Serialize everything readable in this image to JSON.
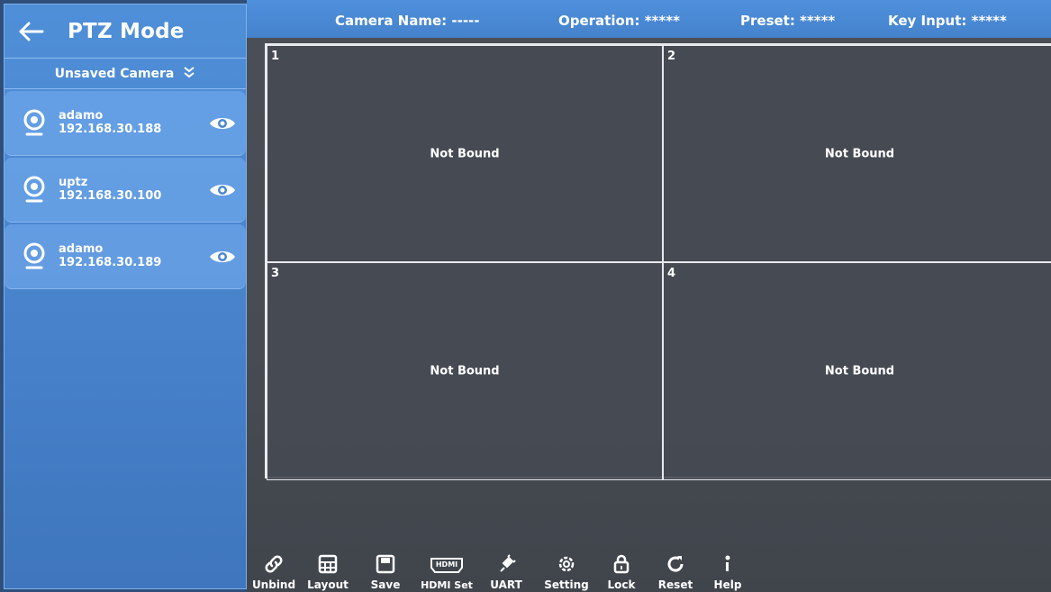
{
  "sidebar": {
    "title": "PTZ Mode",
    "subheader": "Unsaved Camera",
    "cameras": [
      {
        "name": "adamo",
        "ip": "192.168.30.188"
      },
      {
        "name": "uptz",
        "ip": "192.168.30.100"
      },
      {
        "name": "adamo",
        "ip": "192.168.30.189"
      }
    ]
  },
  "topbar": {
    "camera_name": "Camera Name: -----",
    "operation": "Operation: *****",
    "preset": "Preset: *****",
    "key_input": "Key Input: *****"
  },
  "grid": {
    "cells": [
      {
        "number": "1",
        "status": "Not Bound"
      },
      {
        "number": "2",
        "status": "Not Bound"
      },
      {
        "number": "3",
        "status": "Not Bound"
      },
      {
        "number": "4",
        "status": "Not Bound"
      }
    ]
  },
  "toolbar": {
    "items": [
      {
        "label": "Unbind",
        "icon": "link-icon"
      },
      {
        "label": "Layout",
        "icon": "grid-icon"
      },
      {
        "label": "Save",
        "icon": "save-icon"
      },
      {
        "label": "HDMI Set",
        "icon": "hdmi-icon"
      },
      {
        "label": "UART",
        "icon": "plug-icon"
      },
      {
        "label": "Setting",
        "icon": "gear-icon"
      },
      {
        "label": "Lock",
        "icon": "lock-icon"
      },
      {
        "label": "Reset",
        "icon": "reset-icon"
      },
      {
        "label": "Help",
        "icon": "help-icon"
      }
    ]
  },
  "colors": {
    "accent": "#4a86cf",
    "panel": "#474b52",
    "grid_line": "#e8eaee"
  }
}
